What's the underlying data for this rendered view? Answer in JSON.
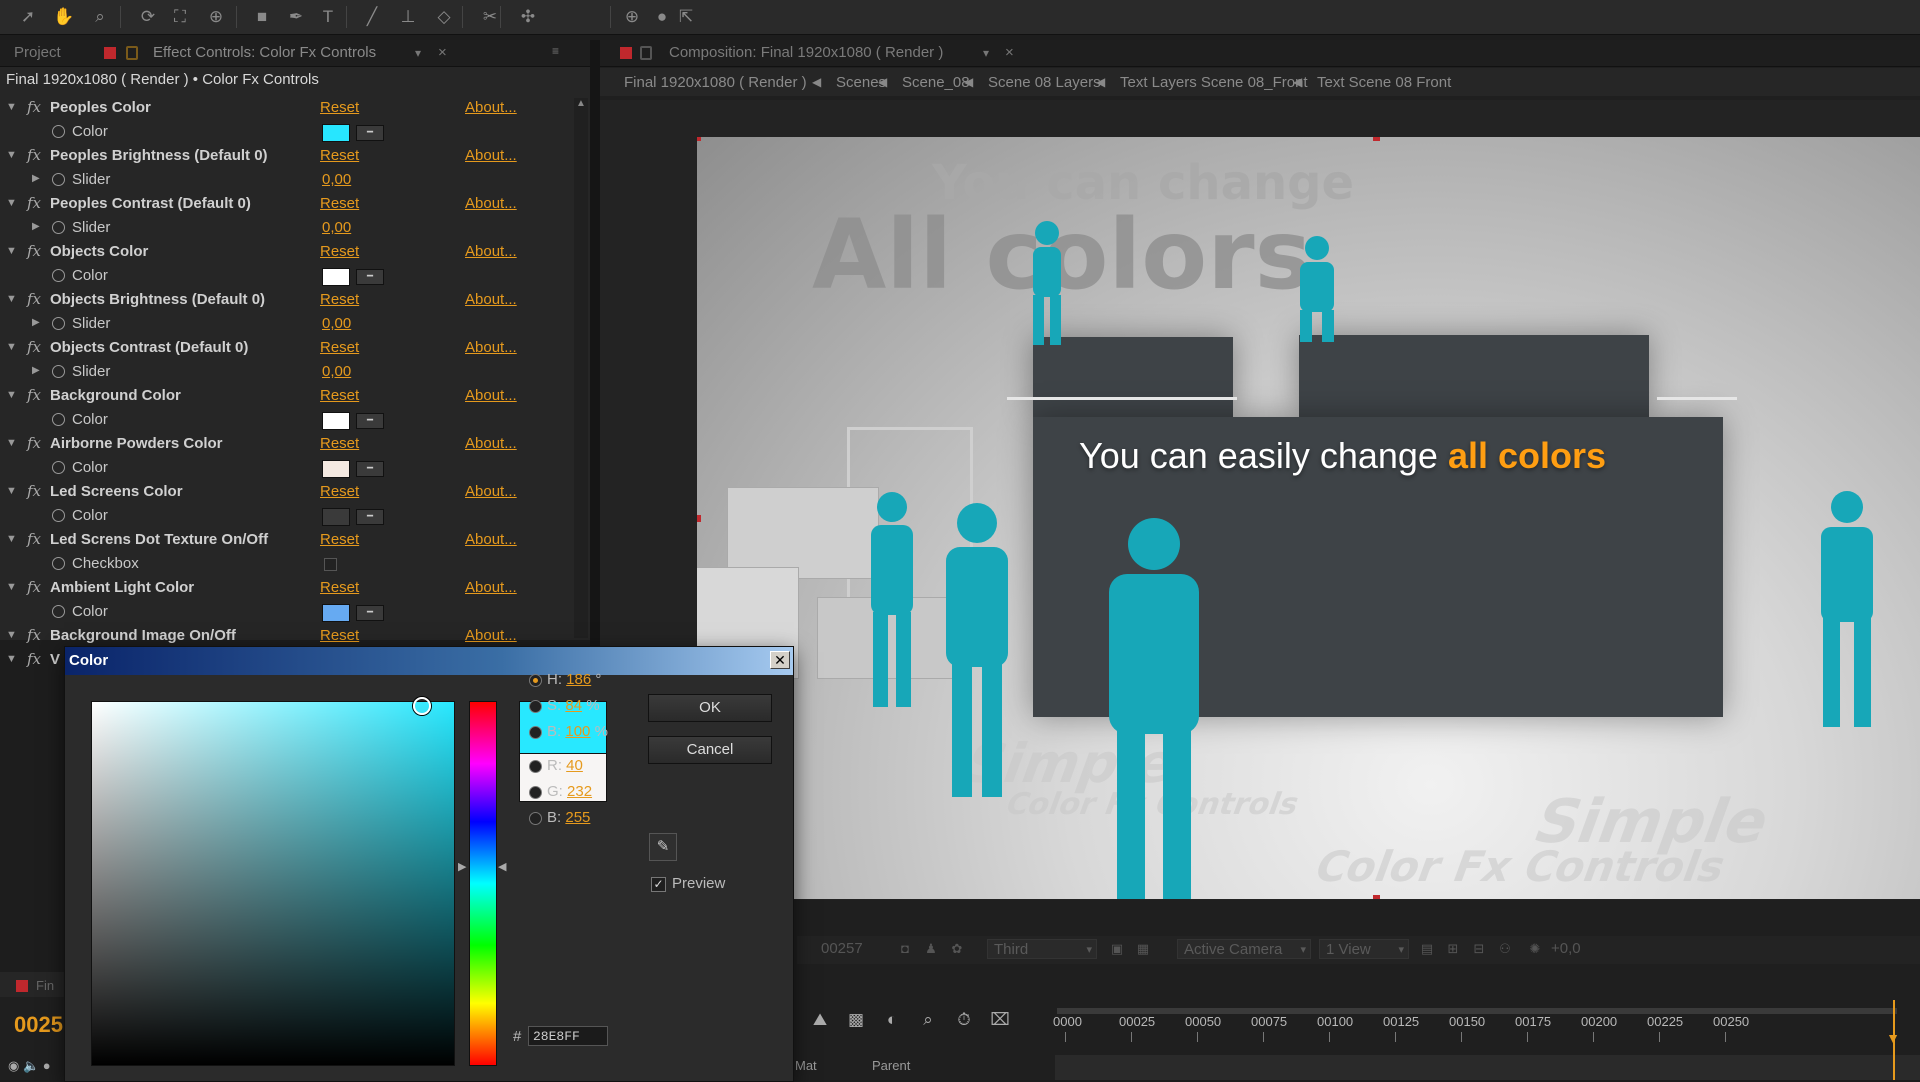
{
  "toolbar": {
    "tools": [
      "selection-tool",
      "hand-tool",
      "zoom-tool",
      "rotate-tool",
      "camera-tool",
      "pan-behind-tool",
      "rectangle-tool",
      "pen-tool",
      "text-tool",
      "brush-tool",
      "clone-stamp-tool",
      "eraser-tool",
      "roto-brush-tool",
      "puppet-tool"
    ]
  },
  "left_panel": {
    "tabs": {
      "project": "Project",
      "effect_controls": "Effect Controls: Color Fx Controls"
    },
    "breadcrumb": "Final 1920x1080 ( Render ) • Color Fx Controls",
    "reset_label": "Reset",
    "about_label": "About...",
    "effects": [
      {
        "name": "Peoples Color",
        "prop": "Color",
        "kind": "color",
        "swatch": "#27e6ff"
      },
      {
        "name": "Peoples Brightness (Default 0)",
        "prop": "Slider",
        "kind": "slider",
        "value": "0,00"
      },
      {
        "name": "Peoples Contrast (Default 0)",
        "prop": "Slider",
        "kind": "slider",
        "value": "0,00"
      },
      {
        "name": "Objects Color",
        "prop": "Color",
        "kind": "color",
        "swatch": "#ffffff"
      },
      {
        "name": "Objects Brightness (Default 0)",
        "prop": "Slider",
        "kind": "slider",
        "value": "0,00"
      },
      {
        "name": "Objects Contrast (Default 0)",
        "prop": "Slider",
        "kind": "slider",
        "value": "0,00"
      },
      {
        "name": "Background Color",
        "prop": "Color",
        "kind": "color",
        "swatch": "#ffffff"
      },
      {
        "name": "Airborne Powders Color",
        "prop": "Color",
        "kind": "color",
        "swatch": "#f4e9e1"
      },
      {
        "name": "Led Screens Color",
        "prop": "Color",
        "kind": "color",
        "swatch": "#3a3a3a"
      },
      {
        "name": "Led Screns Dot Texture  On/Off",
        "prop": "Checkbox",
        "kind": "checkbox"
      },
      {
        "name": "Ambient Light Color",
        "prop": "Color",
        "kind": "color",
        "swatch": "#66aaf2"
      },
      {
        "name": "Background Image  On/Off",
        "prop": "",
        "kind": "none"
      },
      {
        "name": "V",
        "prop": "",
        "kind": "none"
      }
    ]
  },
  "comp_panel": {
    "tab": "Composition: Final 1920x1080 ( Render )",
    "breadcrumbs": [
      "Final 1920x1080 ( Render )",
      "Scenes",
      "Scene_08",
      "Scene 08 Layers",
      "Text Layers Scene 08_Front",
      "Text Scene 08 Front"
    ],
    "viewer": {
      "bg_line1": "You can change",
      "bg_line2": "All colors",
      "headline_plain": "You can easily change ",
      "headline_highlight": "all colors",
      "floor_text1": "Simple",
      "floor_text2": "Color Fx Controls",
      "floor_text3": "Simple",
      "floor_text4": "Color Fx Controls"
    },
    "bottom_bar": {
      "frame": "00257",
      "view_mode": "Third",
      "camera": "Active Camera",
      "views": "1 View",
      "exposure": "+0,0"
    }
  },
  "timeline": {
    "timecode": "0025",
    "tab_label": "Fin",
    "column_labels": {
      "mat": "Mat",
      "parent": "Parent"
    },
    "ruler_ticks": [
      "0000",
      "00025",
      "00050",
      "00075",
      "00100",
      "00125",
      "00150",
      "00175",
      "00200",
      "00225",
      "00250"
    ],
    "current_frame": 257
  },
  "color_dialog": {
    "title": "Color",
    "close": "✕",
    "ok_label": "OK",
    "cancel_label": "Cancel",
    "fields": [
      {
        "label": "H:",
        "value": "186",
        "unit": "°",
        "selected": true
      },
      {
        "label": "S:",
        "value": "84",
        "unit": "%",
        "selected": false
      },
      {
        "label": "B:",
        "value": "100",
        "unit": "%",
        "selected": false
      },
      {
        "label": "R:",
        "value": "40",
        "unit": "",
        "selected": false
      },
      {
        "label": "G:",
        "value": "232",
        "unit": "",
        "selected": false
      },
      {
        "label": "B:",
        "value": "255",
        "unit": "",
        "selected": false
      }
    ],
    "hex_prefix": "#",
    "hex_value": "28E8FF",
    "new_color": "#28e8ff",
    "old_color": "#f7f5f4",
    "preview_label": "Preview",
    "preview_checked": true
  },
  "colors": {
    "accent_orange": "#e69a1d",
    "people_cyan": "#17a7b8",
    "headline_orange": "#ff9e12"
  }
}
